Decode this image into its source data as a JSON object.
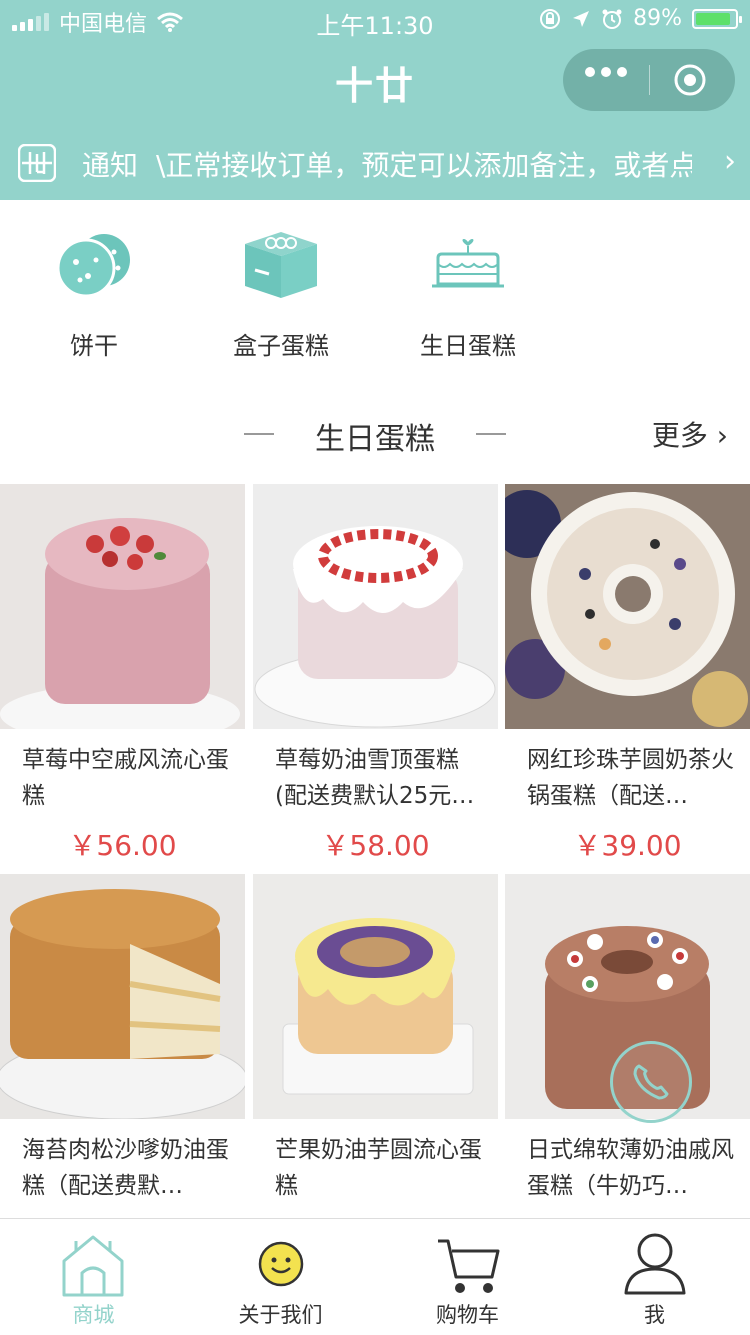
{
  "status_bar": {
    "carrier": "中国电信",
    "time": "上午11:30",
    "battery_percent": "89%",
    "battery_level": 0.89
  },
  "header": {
    "title": "十廿",
    "accent_color": "#93d3cb"
  },
  "notice": {
    "label": "通知",
    "text": "\\正常接收订单，预定可以添加备注，或者点"
  },
  "categories": [
    {
      "label": "饼干",
      "icon": "cookie-icon"
    },
    {
      "label": "盒子蛋糕",
      "icon": "cake-box-icon"
    },
    {
      "label": "生日蛋糕",
      "icon": "birthday-cake-icon"
    }
  ],
  "section": {
    "title": "生日蛋糕",
    "more_label": "更多"
  },
  "products": [
    {
      "name": "草莓中空戚风流心蛋糕",
      "price": "￥56.00",
      "image": "pink-strawberry-cake"
    },
    {
      "name": "草莓奶油雪顶蛋糕(配送费默认25元…",
      "price": "￥58.00",
      "image": "white-drip-strawberry-cake"
    },
    {
      "name": "网红珍珠芋圆奶茶火锅蛋糕（配送…",
      "price": "￥39.00",
      "image": "ring-pearl-cake"
    },
    {
      "name": "海苔肉松沙嗲奶油蛋糕（配送费默…",
      "price": "",
      "image": "pork-floss-cake"
    },
    {
      "name": "芒果奶油芋圆流心蛋糕",
      "price": "",
      "image": "mango-taro-cake"
    },
    {
      "name": "日式绵软薄奶油戚风蛋糕（牛奶巧…",
      "price": "",
      "image": "chocolate-ring-cake"
    }
  ],
  "tabbar": [
    {
      "label": "商城",
      "icon": "home-icon",
      "active": true
    },
    {
      "label": "关于我们",
      "icon": "smile-icon",
      "active": false
    },
    {
      "label": "购物车",
      "icon": "cart-icon",
      "active": false
    },
    {
      "label": "我",
      "icon": "user-icon",
      "active": false
    }
  ],
  "floating": {
    "icon": "phone-icon"
  }
}
